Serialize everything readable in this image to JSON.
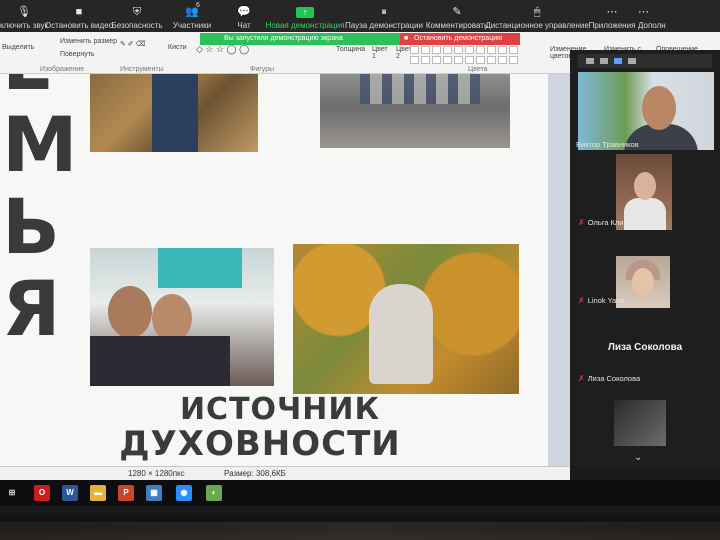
{
  "zoom_toolbar": {
    "items": [
      {
        "icon": "microphone-icon",
        "glyph": "🎙",
        "label": "ключить звук"
      },
      {
        "icon": "video-camera-icon",
        "glyph": "■",
        "label": "Остановить видео"
      },
      {
        "icon": "shield-icon",
        "glyph": "⛨",
        "label": "Безопасность"
      },
      {
        "icon": "participants-icon",
        "glyph": "👥",
        "label": "Участники",
        "badge": "6"
      },
      {
        "icon": "chat-icon",
        "glyph": "💬",
        "label": "Чат"
      },
      {
        "icon": "share-screen-icon",
        "glyph": "↑",
        "label": "Новая демонстрация"
      },
      {
        "icon": "pause-icon",
        "glyph": "⏸",
        "label": "Пауза демонстрации"
      },
      {
        "icon": "annotate-icon",
        "glyph": "✎",
        "label": "Комментировать"
      },
      {
        "icon": "remote-control-icon",
        "glyph": "🖱",
        "label": "Дистанционное управление"
      },
      {
        "icon": "more-icon",
        "glyph": "⋯",
        "label": "Приложения"
      },
      {
        "icon": "more-icon",
        "glyph": "⋯",
        "label": "Дополн"
      }
    ]
  },
  "sharing_banner": {
    "status": "Вы запустили демонстрацию экрана",
    "stop_label": "Остановить демонстрацию"
  },
  "paint_ribbon": {
    "select_label": "Выделить",
    "resize_label": "Изменить размер",
    "rotate_label": "Повернуть",
    "brushes_label": "Кисти",
    "thickness_label": "Толщина",
    "color1_label": "Цвет 1",
    "color2_label": "Цвет 2",
    "edit_colors_label": "Изменение цветов",
    "edit_with_label": "Изменить с",
    "update_label": "Оповещение",
    "groups": {
      "image": "Изображение",
      "tools": "Инструменты",
      "shapes": "Фигуры",
      "colors": "Цвета"
    }
  },
  "slide": {
    "vertical_letters": [
      "Е",
      "М",
      "Ь",
      "Я"
    ],
    "caption_line1": "ИСТОЧНИК",
    "caption_line2": "ДУХОВНОСТИ"
  },
  "paint_status": {
    "dimensions": "1280 × 1280пкс",
    "size": "Размер: 308,6КБ"
  },
  "participants": [
    {
      "name": "Виктор Травников",
      "muted": false
    },
    {
      "name": "Ольга Клименко",
      "muted": true
    },
    {
      "name": "Linok Yana",
      "muted": true
    },
    {
      "name": "Лиза Соколова",
      "muted": true
    }
  ],
  "participant_highlight": "Лиза Соколова",
  "taskbar": {
    "apps": [
      {
        "icon": "opera-icon",
        "glyph": "O",
        "color": "#c81e1e"
      },
      {
        "icon": "word-icon",
        "glyph": "W",
        "color": "#2b5797"
      },
      {
        "icon": "file-explorer-icon",
        "glyph": "▬",
        "color": "#e2b43a"
      },
      {
        "icon": "powerpoint-icon",
        "glyph": "P",
        "color": "#c8462a"
      },
      {
        "icon": "paint-icon",
        "glyph": "▦",
        "color": "#3f7fbf"
      },
      {
        "icon": "zoom-icon",
        "glyph": "◉",
        "color": "#2d8cff"
      },
      {
        "icon": "photos-icon",
        "glyph": "◐",
        "color": "#6aa84f"
      }
    ]
  }
}
